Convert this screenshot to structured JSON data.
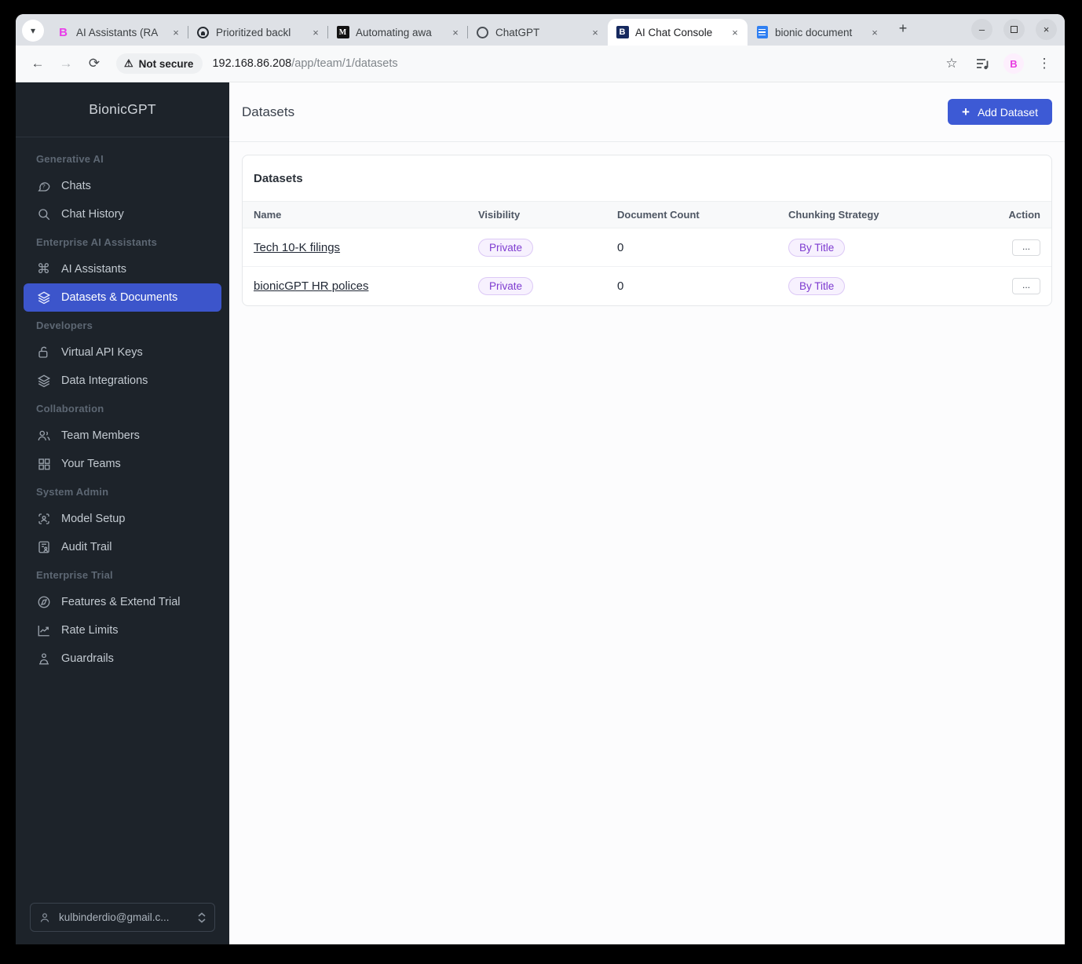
{
  "browser": {
    "tabs": [
      {
        "label": "AI Assistants (RA",
        "favicon": "bionicgpt-pink"
      },
      {
        "label": "Prioritized backl",
        "favicon": "github"
      },
      {
        "label": "Automating awa",
        "favicon": "medium",
        "medium_glyph": "M"
      },
      {
        "label": "ChatGPT",
        "favicon": "chatgpt"
      },
      {
        "label": "AI Chat Console",
        "favicon": "bionicgpt-navy",
        "navy_glyph": "B"
      },
      {
        "label": "bionic document",
        "favicon": "google-docs"
      }
    ],
    "pink_glyph": "B",
    "close_glyph": "×",
    "new_tab_glyph": "+",
    "window_controls": {
      "minimize": "–",
      "close": "×"
    },
    "toolbar": {
      "back": "←",
      "forward": "→",
      "reload": "⟳",
      "security_label": "Not secure",
      "warning_glyph": "⚠",
      "url_host": "192.168.86.208",
      "url_path": "/app/team/1/datasets",
      "star_glyph": "☆",
      "menu_glyph": "⋮",
      "extension_glyph": "B"
    }
  },
  "sidebar": {
    "brand": "BionicGPT",
    "items": [
      {
        "type": "section",
        "label": "Generative AI"
      },
      {
        "type": "item",
        "label": "Chats"
      },
      {
        "type": "item",
        "label": "Chat History"
      },
      {
        "type": "section",
        "label": "Enterprise AI Assistants"
      },
      {
        "type": "item",
        "label": "AI Assistants",
        "glyph": "⌘"
      },
      {
        "type": "item",
        "label": "Datasets & Documents",
        "active": true
      },
      {
        "type": "section",
        "label": "Developers"
      },
      {
        "type": "item",
        "label": "Virtual API Keys"
      },
      {
        "type": "item",
        "label": "Data Integrations"
      },
      {
        "type": "section",
        "label": "Collaboration"
      },
      {
        "type": "item",
        "label": "Team Members"
      },
      {
        "type": "item",
        "label": "Your Teams"
      },
      {
        "type": "section",
        "label": "System Admin"
      },
      {
        "type": "item",
        "label": "Model Setup"
      },
      {
        "type": "item",
        "label": "Audit Trail"
      },
      {
        "type": "section",
        "label": "Enterprise Trial"
      },
      {
        "type": "item",
        "label": "Features & Extend Trial"
      },
      {
        "type": "item",
        "label": "Rate Limits"
      },
      {
        "type": "item",
        "label": "Guardrails"
      }
    ],
    "user_email": "kulbinderdio@gmail.c..."
  },
  "main": {
    "page_title": "Datasets",
    "add_button_label": "Add Dataset",
    "add_button_plus": "+",
    "card": {
      "title": "Datasets",
      "columns": [
        "Name",
        "Visibility",
        "Document Count",
        "Chunking Strategy",
        "Action"
      ],
      "rows": [
        {
          "name": "Tech 10-K filings",
          "visibility": "Private",
          "document_count": "0",
          "chunking_strategy": "By Title",
          "action": "..."
        },
        {
          "name": "bionicGPT HR polices",
          "visibility": "Private",
          "document_count": "0",
          "chunking_strategy": "By Title",
          "action": "..."
        }
      ]
    }
  },
  "colors": {
    "accent_blue": "#3d5ad5",
    "sidebar_active": "#3c55cb",
    "badge_purple": "#7e3bd0",
    "sidebar_bg": "#1d232a"
  }
}
